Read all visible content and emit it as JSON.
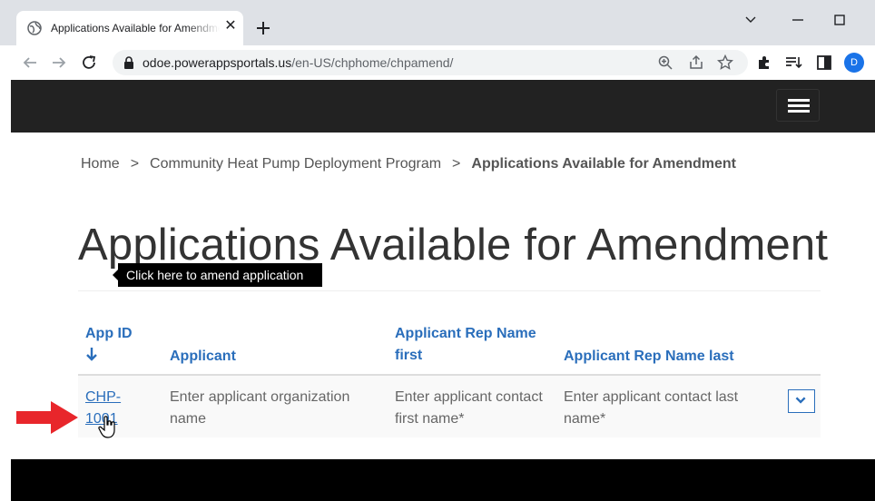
{
  "browser": {
    "tab_title": "Applications Available for Amendment",
    "url_host": "odoe.powerappsportals.us",
    "url_path": "/en-US/chphome/chpamend/",
    "profile_initial": "D",
    "icons": [
      "globe-icon",
      "close-icon",
      "new-tab-icon",
      "chevron-down-icon",
      "minimize-icon",
      "maximize-icon",
      "back-icon",
      "forward-icon",
      "reload-icon",
      "lock-icon",
      "zoom-icon",
      "share-icon",
      "star-icon",
      "extensions-icon",
      "reading-list-icon",
      "side-panel-icon"
    ]
  },
  "colors": {
    "navbar": "#222222",
    "link": "#2a6ebb",
    "annotation_arrow": "#e8262b",
    "avatar": "#1a73e8"
  },
  "breadcrumb": {
    "home": "Home",
    "separator": ">",
    "program": "Community Heat Pump Deployment Program",
    "current": "Applications Available for Amendment"
  },
  "page": {
    "title": "Applications Available for Amendment"
  },
  "table": {
    "headers": {
      "app_id": "App ID",
      "applicant": "Applicant",
      "rep_first": "Applicant Rep Name first",
      "rep_last": "Applicant Rep Name last"
    },
    "rows": [
      {
        "app_id": "CHP-1001",
        "applicant": "Enter applicant organization name",
        "rep_first": "Enter applicant contact first name*",
        "rep_last": "Enter applicant contact last name*"
      }
    ]
  },
  "tooltip": "Click here to amend application"
}
